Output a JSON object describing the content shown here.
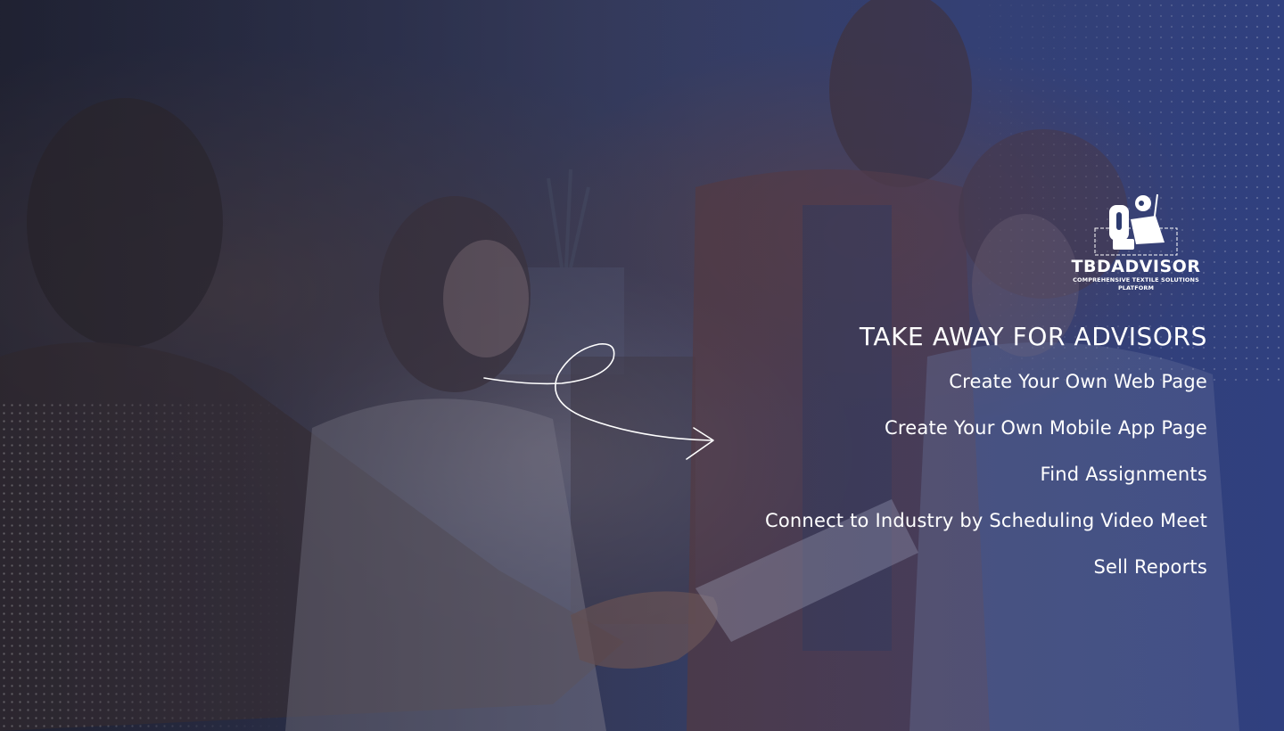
{
  "brand": {
    "name": "TBDADVISOR",
    "tagline": "COMPREHENSIVE TEXTILE SOLUTIONS PLATFORM"
  },
  "heading": "TAKE AWAY FOR ADVISORS",
  "items": [
    {
      "label": "Create Your Own Web Page"
    },
    {
      "label": "Create Your Own Mobile App Page"
    },
    {
      "label": "Find Assignments"
    },
    {
      "label": "Connect to Industry by Scheduling Video Meet"
    },
    {
      "label": "Sell Reports"
    }
  ],
  "colors": {
    "text": "#ffffff",
    "overlay": "#2d3e82"
  }
}
